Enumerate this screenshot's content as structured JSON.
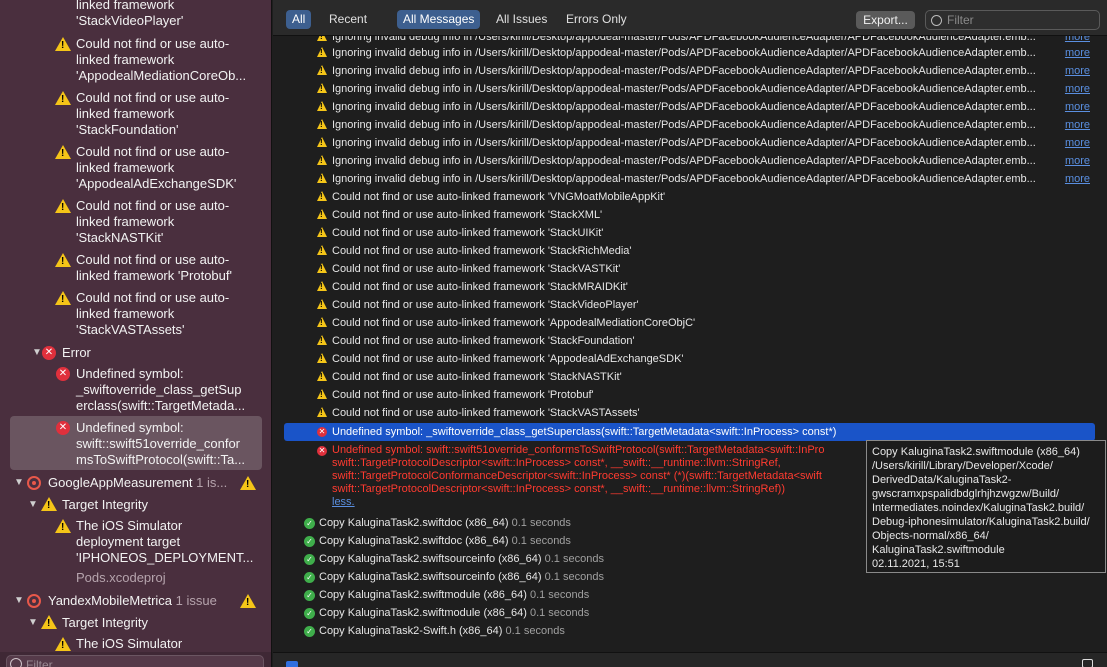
{
  "sidebar": {
    "warnings": [
      {
        "label": "linked framework 'StackVideoPlayer'"
      },
      {
        "label": "Could not find or use auto-linked framework 'AppodealMediationCoreOb..."
      },
      {
        "label": "Could not find or use auto-linked framework 'StackFoundation'"
      },
      {
        "label": "Could not find or use auto-linked framework 'AppodealAdExchangeSDK'"
      },
      {
        "label": "Could not find or use auto-linked framework 'StackNASTKit'"
      },
      {
        "label": "Could not find or use auto-linked framework 'Protobuf'"
      },
      {
        "label": "Could not find or use auto-linked framework 'StackVASTAssets'"
      }
    ],
    "error_group": {
      "label": "Error",
      "items": [
        {
          "label": "Undefined symbol: _swiftoverride_class_getSuperclass(swift::TargetMetada..."
        },
        {
          "label": "Undefined symbol: swift::swift51override_conformsToSwiftProtocol(swift::Ta..."
        }
      ]
    },
    "google": {
      "label": "GoogleAppMeasurement",
      "count": "1 is...",
      "target_label": "Target Integrity",
      "issue": "The iOS Simulator deployment target 'IPHONEOS_DEPLOYMENT...",
      "sub": "Pods.xcodeproj"
    },
    "yandex": {
      "label": "YandexMobileMetrica",
      "count": "1 issue",
      "target_label": "Target Integrity",
      "issue": "The iOS Simulator"
    },
    "filter_placeholder": "Filter"
  },
  "toolbar": {
    "all": "All",
    "recent": "Recent",
    "all_messages": "All Messages",
    "all_issues": "All Issues",
    "errors_only": "Errors Only",
    "export": "Export...",
    "filter_placeholder": "Filter"
  },
  "log": {
    "more_label": "more",
    "ignoring": [
      "Ignoring invalid debug info in /Users/kirill/Desktop/appodeal-master/Pods/APDFacebookAudienceAdapter/APDFacebookAudienceAdapter.emb...",
      "Ignoring invalid debug info in /Users/kirill/Desktop/appodeal-master/Pods/APDFacebookAudienceAdapter/APDFacebookAudienceAdapter.emb...",
      "Ignoring invalid debug info in /Users/kirill/Desktop/appodeal-master/Pods/APDFacebookAudienceAdapter/APDFacebookAudienceAdapter.emb...",
      "Ignoring invalid debug info in /Users/kirill/Desktop/appodeal-master/Pods/APDFacebookAudienceAdapter/APDFacebookAudienceAdapter.emb...",
      "Ignoring invalid debug info in /Users/kirill/Desktop/appodeal-master/Pods/APDFacebookAudienceAdapter/APDFacebookAudienceAdapter.emb...",
      "Ignoring invalid debug info in /Users/kirill/Desktop/appodeal-master/Pods/APDFacebookAudienceAdapter/APDFacebookAudienceAdapter.emb...",
      "Ignoring invalid debug info in /Users/kirill/Desktop/appodeal-master/Pods/APDFacebookAudienceAdapter/APDFacebookAudienceAdapter.emb...",
      "Ignoring invalid debug info in /Users/kirill/Desktop/appodeal-master/Pods/APDFacebookAudienceAdapter/APDFacebookAudienceAdapter.emb...",
      "Ignoring invalid debug info in /Users/kirill/Desktop/appodeal-master/Pods/APDFacebookAudienceAdapter/APDFacebookAudienceAdapter.emb..."
    ],
    "frameworks": [
      "Could not find or use auto-linked framework 'VNGMoatMobileAppKit'",
      "Could not find or use auto-linked framework 'StackXML'",
      "Could not find or use auto-linked framework 'StackUIKit'",
      "Could not find or use auto-linked framework 'StackRichMedia'",
      "Could not find or use auto-linked framework 'StackVASTKit'",
      "Could not find or use auto-linked framework 'StackMRAIDKit'",
      "Could not find or use auto-linked framework 'StackVideoPlayer'",
      "Could not find or use auto-linked framework 'AppodealMediationCoreObjC'",
      "Could not find or use auto-linked framework 'StackFoundation'",
      "Could not find or use auto-linked framework 'AppodealAdExchangeSDK'",
      "Could not find or use auto-linked framework 'StackNASTKit'",
      "Could not find or use auto-linked framework 'Protobuf'",
      "Could not find or use auto-linked framework 'StackVASTAssets'"
    ],
    "selected_error": "Undefined symbol: _swiftoverride_class_getSuperclass(swift::TargetMetadata<swift::InProcess> const*)",
    "error_detail": [
      "Undefined symbol: swift::swift51override_conformsToSwiftProtocol(swift::TargetMetadata<swift::InPro",
      "swift::TargetProtocolDescriptor<swift::InProcess> const*, __swift::__runtime::llvm::StringRef,",
      "swift::TargetProtocolConformanceDescriptor<swift::InProcess> const* (*)(swift::TargetMetadata<swift",
      "swift::TargetProtocolDescriptor<swift::InProcess> const*, __swift::__runtime::llvm::StringRef))"
    ],
    "less_label": "less.",
    "copies": [
      {
        "name": "Copy KaluginaTask2.swiftdoc (x86_64)",
        "time": "0.1 seconds"
      },
      {
        "name": "Copy KaluginaTask2.swiftdoc (x86_64)",
        "time": "0.1 seconds"
      },
      {
        "name": "Copy KaluginaTask2.swiftsourceinfo (x86_64)",
        "time": "0.1 seconds"
      },
      {
        "name": "Copy KaluginaTask2.swiftsourceinfo (x86_64)",
        "time": "0.1 seconds"
      },
      {
        "name": "Copy KaluginaTask2.swiftmodule (x86_64)",
        "time": "0.1 seconds"
      },
      {
        "name": "Copy KaluginaTask2.swiftmodule (x86_64)",
        "time": "0.1 seconds"
      },
      {
        "name": "Copy KaluginaTask2-Swift.h (x86_64)",
        "time": "0.1 seconds"
      }
    ]
  },
  "tooltip": {
    "lines": [
      "Copy KaluginaTask2.swiftmodule (x86_64)",
      "/Users/kirill/Library/Developer/Xcode/",
      "DerivedData/KaluginaTask2-",
      "gwscramxpspalidbdglrhjhzwgzw/Build/",
      "Intermediates.noindex/KaluginaTask2.build/",
      "Debug-iphonesimulator/KaluginaTask2.build/",
      "Objects-normal/x86_64/",
      "KaluginaTask2.swiftmodule",
      "02.11.2021, 15:51"
    ]
  },
  "colors": {
    "sidebar_bg": "#4a2f3e",
    "selection_blue": "#1a54c8",
    "error_red": "#ff3b30",
    "warning_yellow": "#f5c518",
    "success_green": "#3fae4b",
    "link_blue": "#5a8fe0"
  }
}
